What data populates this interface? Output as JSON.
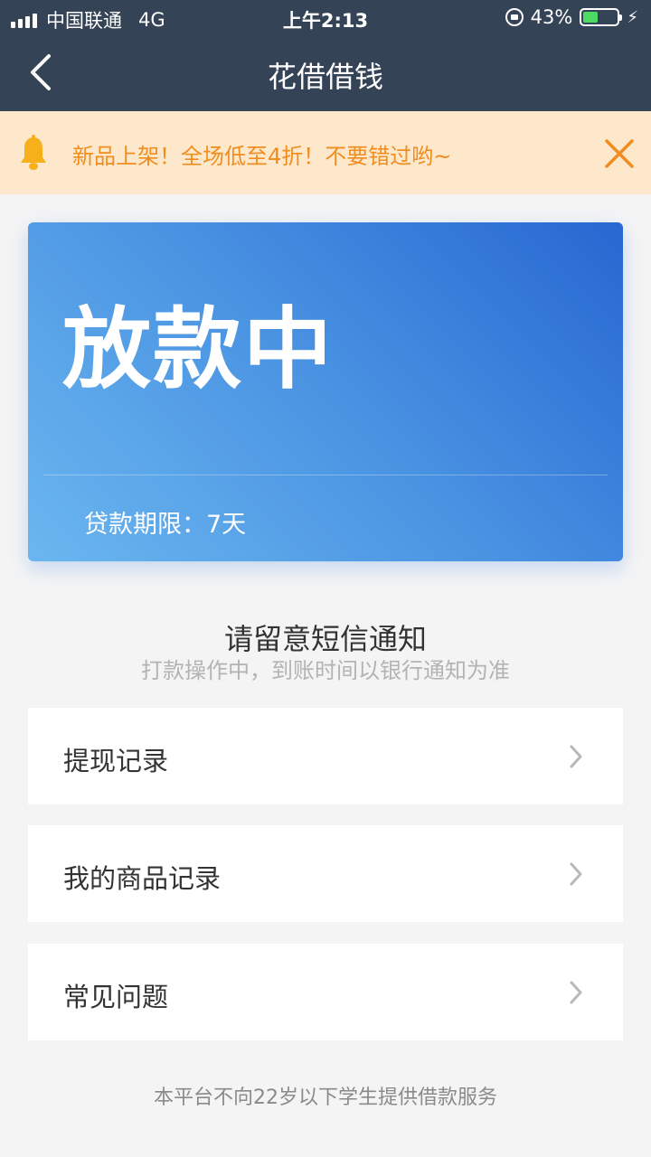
{
  "status_bar": {
    "carrier": "中国联通",
    "network": "4G",
    "time": "上午2:13",
    "battery": "43%",
    "battery_level": 0.43
  },
  "nav": {
    "title": "花借借钱",
    "back_icon": "chevron-left-icon"
  },
  "notice": {
    "icon": "bell-icon",
    "text": "新品上架！全场低至4折！不要错过哟~",
    "close_icon": "close-icon",
    "color": "#f18d1e"
  },
  "card": {
    "status": "放款中",
    "term_label": "贷款期限：",
    "term_value": "7天"
  },
  "sms": {
    "title": "请留意短信通知",
    "subtitle": "打款操作中，到账时间以银行通知为准"
  },
  "menu": [
    {
      "label": "提现记录"
    },
    {
      "label": "我的商品记录"
    },
    {
      "label": "常见问题"
    }
  ],
  "footer": "本平台不向22岁以下学生提供借款服务",
  "colors": {
    "header_bg": "#344356",
    "notice_bg": "#fde8cc",
    "card_gradient_start": "#6bb6f0",
    "card_gradient_end": "#2767d1"
  }
}
